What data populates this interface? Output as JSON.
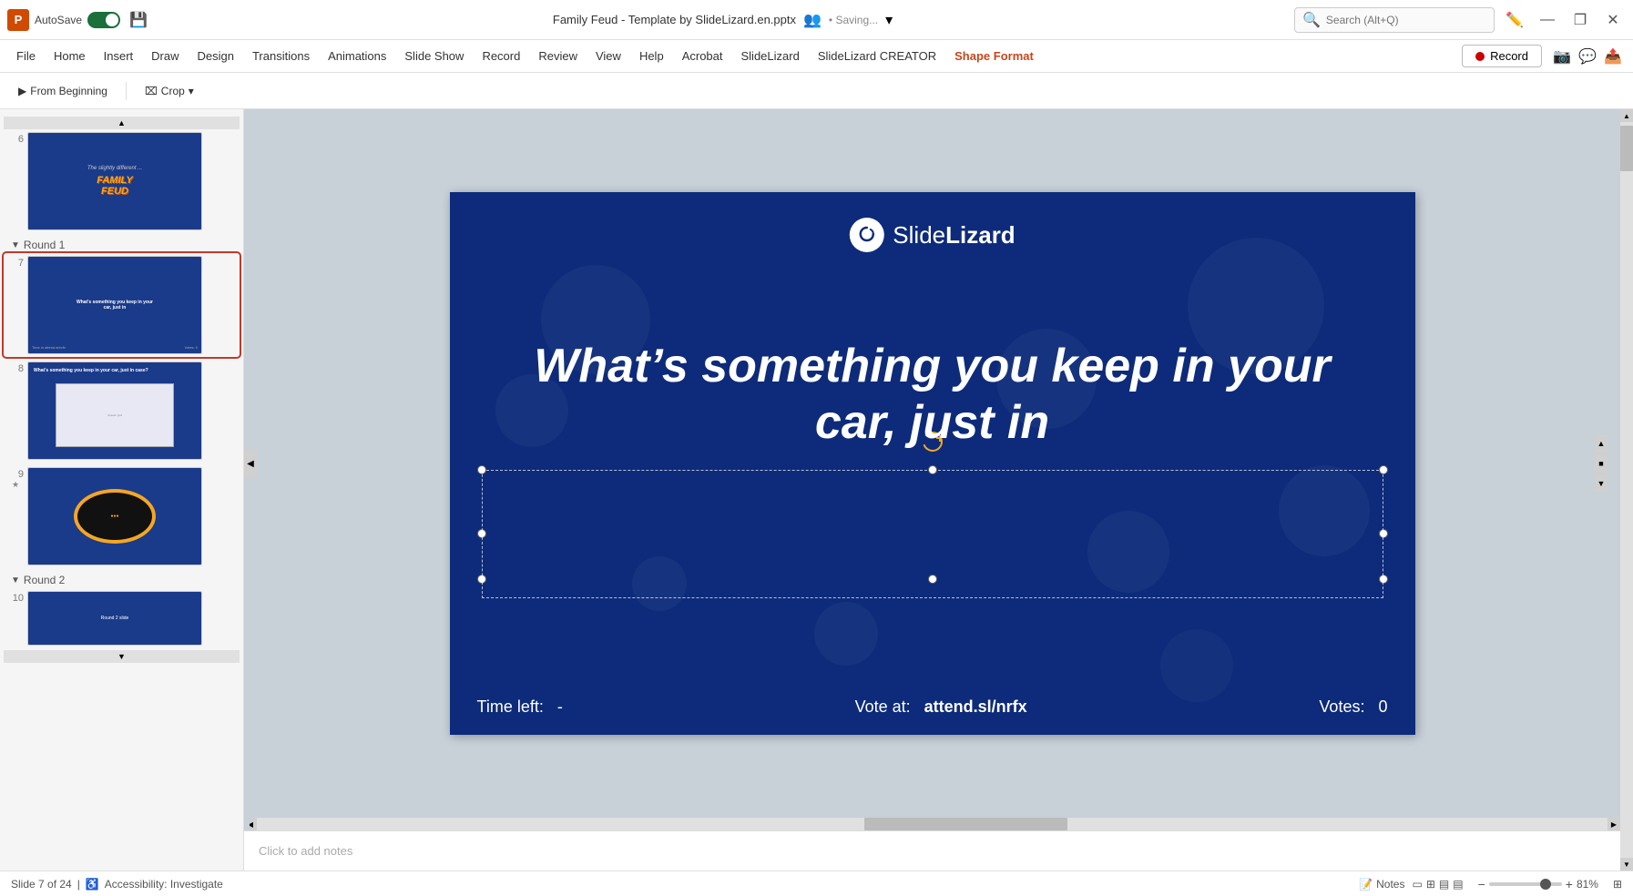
{
  "app": {
    "logo_letter": "P",
    "autosave_label": "AutoSave",
    "toggle_state": "on",
    "file_title": "Family Feud - Template by SlideLizard.en.pptx",
    "collab_icon": "👥",
    "saving_text": "• Saving...",
    "search_placeholder": "Search (Alt+Q)",
    "window_controls": [
      "—",
      "❐",
      "✕"
    ]
  },
  "menu": {
    "items": [
      "File",
      "Home",
      "Insert",
      "Draw",
      "Design",
      "Transitions",
      "Animations",
      "Slide Show",
      "Record",
      "Review",
      "View",
      "Help",
      "Acrobat",
      "SlideLizard",
      "SlideLizard CREATOR"
    ],
    "active_item": "Shape Format",
    "record_btn_label": "Record"
  },
  "toolbar": {
    "from_beginning_label": "From Beginning",
    "crop_label": "Crop",
    "dropdown_arrow": "▾"
  },
  "slide_panel": {
    "sections": [
      {
        "id": "round1",
        "label": "Round 1",
        "collapsed": false,
        "arrow": "▼"
      },
      {
        "id": "round2",
        "label": "Round 2",
        "collapsed": false,
        "arrow": "▼"
      }
    ],
    "slides": [
      {
        "num": "6",
        "starred": false,
        "type": "family-feud-title",
        "section": "before-round1"
      },
      {
        "num": "7",
        "starred": false,
        "type": "question-slide",
        "active": true,
        "section": "round1"
      },
      {
        "num": "8",
        "starred": false,
        "type": "answers-slide",
        "section": "round1"
      },
      {
        "num": "9",
        "starred": true,
        "type": "wheel-slide",
        "section": "round1"
      },
      {
        "num": "10",
        "starred": false,
        "type": "round2-slide",
        "section": "round2"
      }
    ]
  },
  "slide": {
    "logo_text_light": "Slide",
    "logo_text_bold": "Lizard",
    "question_text": "What’s something you keep in your car, just in",
    "time_left_label": "Time left:",
    "time_left_value": "-",
    "vote_label": "Vote at:",
    "vote_url": "attend.sl/nrfx",
    "votes_label": "Votes:",
    "votes_value": "0"
  },
  "status_bar": {
    "slide_count": "Slide 7 of 24",
    "accessibility_label": "Accessibility: Investigate",
    "notes_label": "Notes",
    "zoom_value": "81%",
    "fit_btn": "⊞",
    "view_icons": [
      "▭",
      "⊞",
      "▤"
    ],
    "plus_icon": "+",
    "minus_icon": "−"
  },
  "notes": {
    "placeholder": "Click to add notes"
  },
  "icons": {
    "search": "🔍",
    "pen": "✏️",
    "from_beginning": "▶",
    "crop": "⌧",
    "record_dot": "●",
    "chevron_down": "▾",
    "star": "★",
    "collapse_arrow": "▼",
    "accessibility": "♿",
    "notes_icon": "📝"
  }
}
